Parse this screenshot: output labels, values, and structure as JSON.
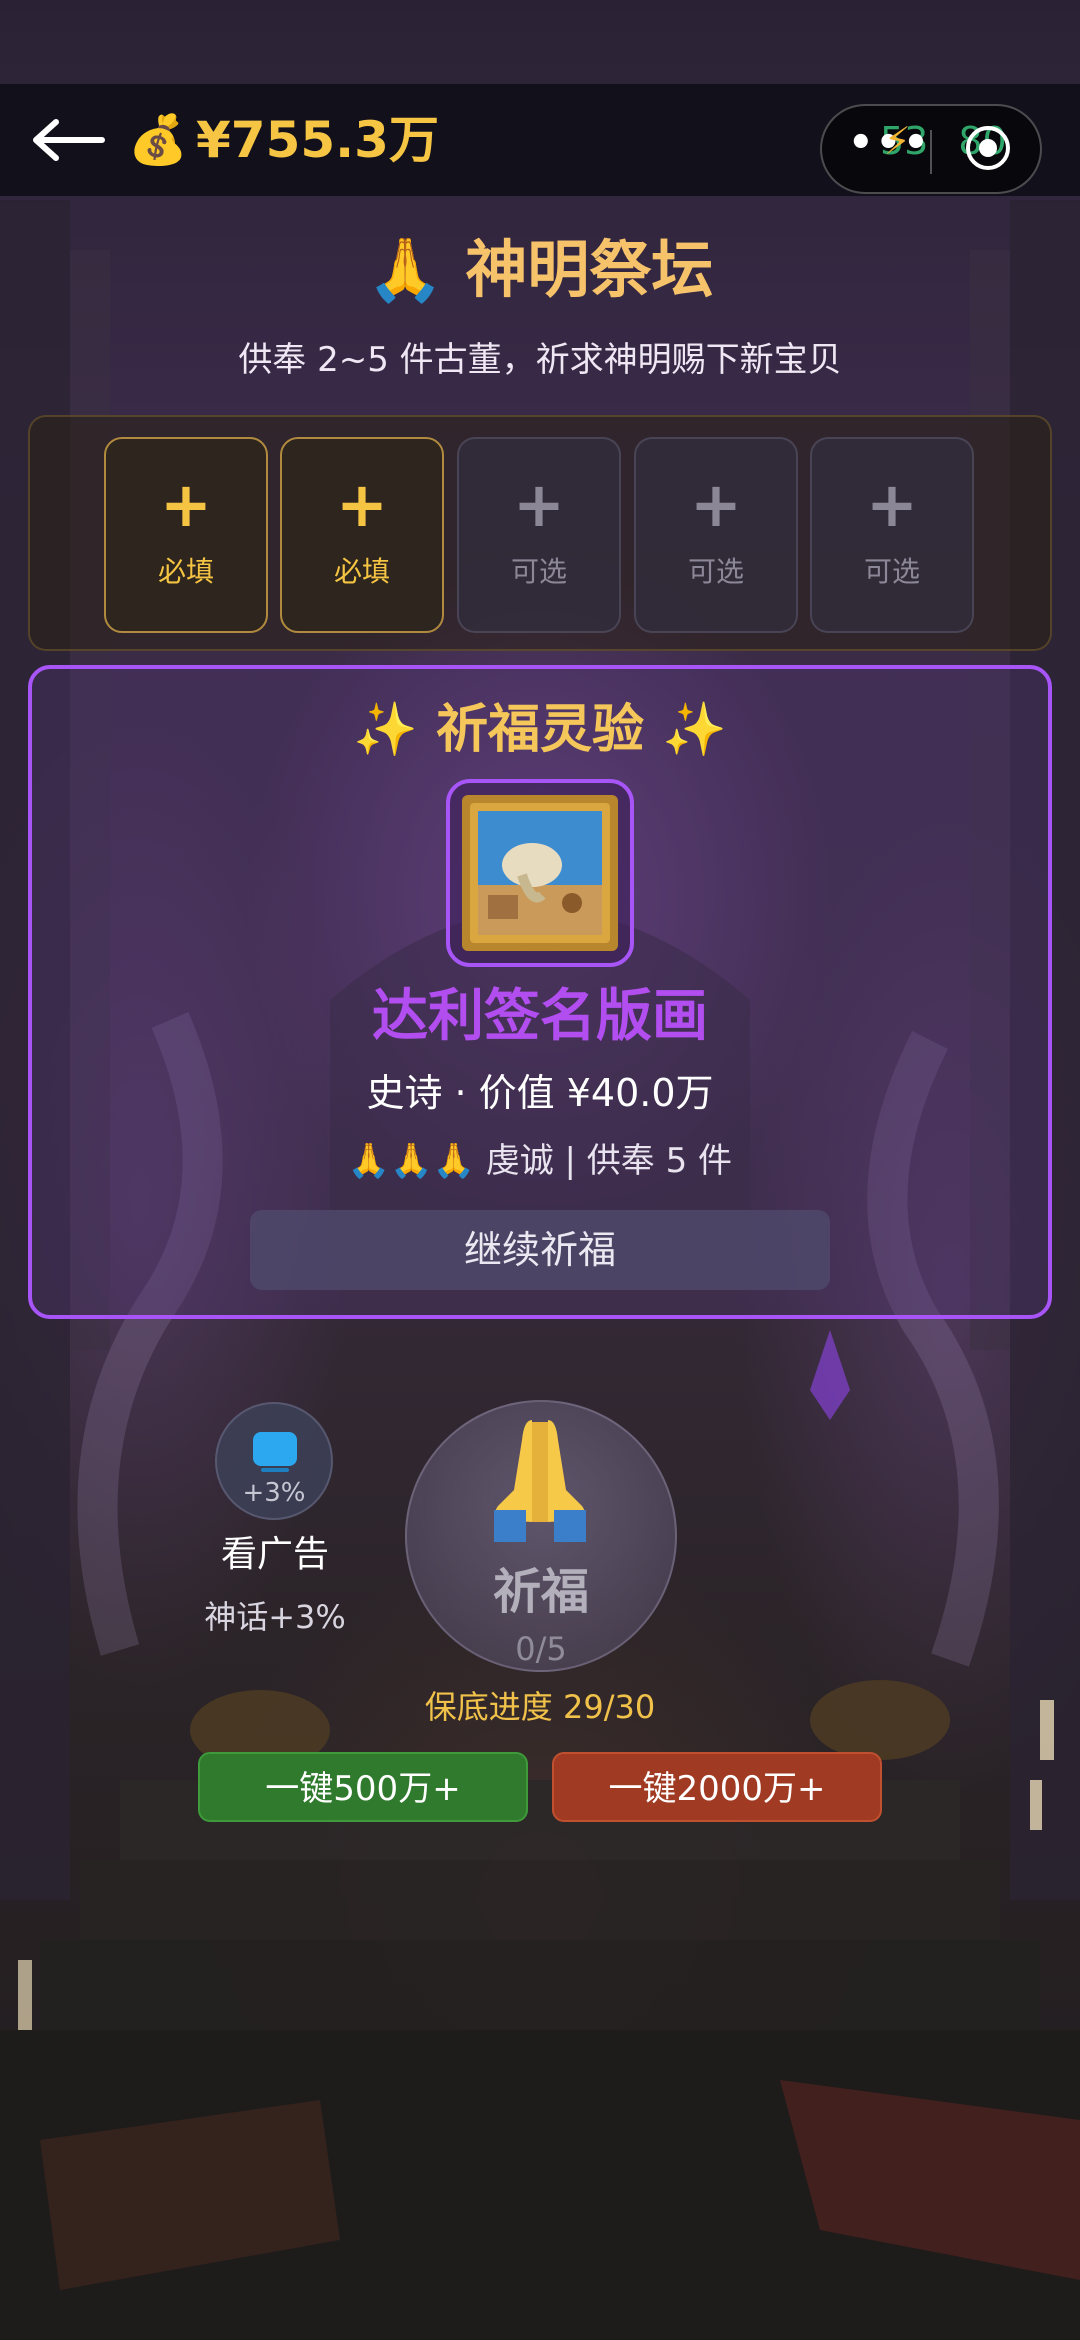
{
  "header": {
    "money_icon": "money-bag-icon",
    "money": "¥755.3万",
    "timer_visible": "53",
    "timer_tail": "80",
    "capsule_more": "•••"
  },
  "altar": {
    "title": "🙏 神明祭坛",
    "subtitle": "供奉 2~5 件古董，祈求神明赐下新宝贝"
  },
  "slots": [
    {
      "plus": "+",
      "label": "必填",
      "type": "required"
    },
    {
      "plus": "+",
      "label": "必填",
      "type": "required"
    },
    {
      "plus": "+",
      "label": "可选",
      "type": "optional"
    },
    {
      "plus": "+",
      "label": "可选",
      "type": "optional"
    },
    {
      "plus": "+",
      "label": "可选",
      "type": "optional"
    }
  ],
  "result": {
    "title": "✨ 祈福灵验 ✨",
    "item_name": "达利签名版画",
    "rarity_value": "史诗 · 价值 ¥40.0万",
    "note": "🙏🙏🙏 虔诚 | 供奉 5 件",
    "continue": "继续祈福",
    "accent": "#a855f7"
  },
  "ad": {
    "bonus": "+3%",
    "label": "看广告",
    "sub": "神话+3%"
  },
  "pray": {
    "label": "祈福",
    "count": "0/5"
  },
  "guarantee": "保底进度 29/30",
  "quick": {
    "green": "一键500万+",
    "red": "一键2000万+"
  }
}
